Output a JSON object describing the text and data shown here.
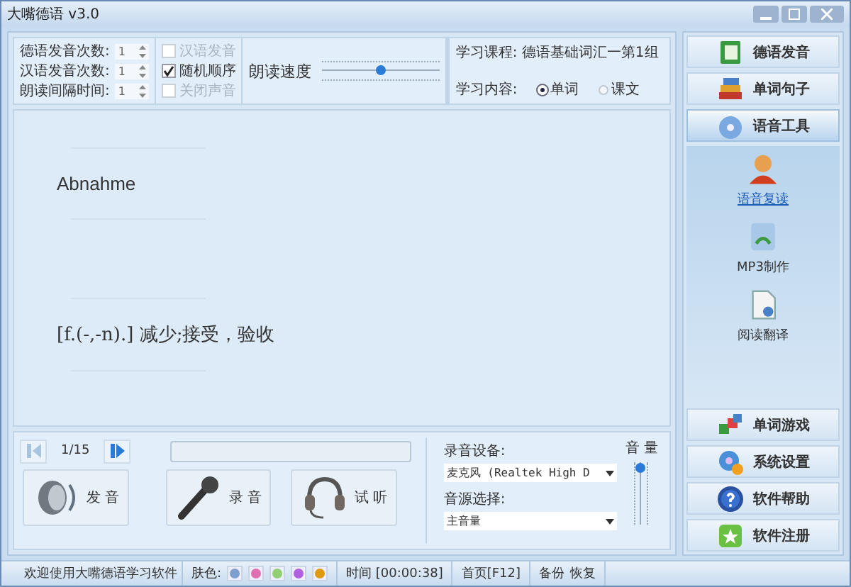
{
  "window": {
    "title": "大嘴德语 v3.0"
  },
  "settings": {
    "spinners": [
      {
        "label": "德语发音次数:",
        "value": "1"
      },
      {
        "label": "汉语发音次数:",
        "value": "1"
      },
      {
        "label": "朗读间隔时间:",
        "value": "1"
      }
    ],
    "checkboxes": [
      {
        "label": "汉语发音",
        "checked": false,
        "disabled": true
      },
      {
        "label": "随机顺序",
        "checked": true,
        "disabled": false
      },
      {
        "label": "关闭声音",
        "checked": false,
        "disabled": true
      }
    ],
    "speed": {
      "label": "朗读速度",
      "level": 0.5
    },
    "course": {
      "label": "学习课程:",
      "value": "德语基础词汇一第1组"
    },
    "content": {
      "label": "学习内容:",
      "options": [
        {
          "label": "单词",
          "selected": true
        },
        {
          "label": "课文",
          "selected": false
        }
      ]
    }
  },
  "card": {
    "word": "Abnahme",
    "meaning": "[f.(-,-n).] 减少;接受，验收"
  },
  "player": {
    "counter": "1/15",
    "progress": {
      "level": 0
    },
    "prev_disabled": true,
    "next_disabled": false,
    "buttons": [
      {
        "kind": "speaker",
        "label": "发 音"
      },
      {
        "kind": "mic",
        "label": "录 音"
      },
      {
        "kind": "headset",
        "label": "试 听"
      }
    ]
  },
  "recording": {
    "device_label": "录音设备:",
    "device": "麦克风 (Realtek High D",
    "source_label": "音源选择:",
    "source": "主音量",
    "volume_label": "音 量",
    "volume": {
      "level": 0.9
    }
  },
  "sidebar": {
    "top": [
      {
        "label": "德语发音",
        "kind": "book",
        "selected": false
      },
      {
        "label": "单词句子",
        "kind": "books",
        "selected": false
      },
      {
        "label": "语音工具",
        "kind": "cd",
        "selected": true
      }
    ],
    "tools": [
      {
        "label": "语音复读",
        "kind": "person",
        "selected": true
      },
      {
        "label": "MP3制作",
        "kind": "mp3",
        "selected": false
      },
      {
        "label": "阅读翻译",
        "kind": "doc",
        "selected": false
      }
    ],
    "bottom": [
      {
        "label": "单词游戏",
        "kind": "blocks",
        "selected": false
      },
      {
        "label": "系统设置",
        "kind": "gear",
        "selected": false
      },
      {
        "label": "软件帮助",
        "kind": "help",
        "selected": false
      },
      {
        "label": "软件注册",
        "kind": "star",
        "selected": false
      }
    ]
  },
  "status_bar": {
    "welcome": "欢迎使用大嘴德语学习软件",
    "skin_label": "肤色:",
    "skins": [
      {
        "color": "#7f9fcf"
      },
      {
        "color": "#e070b0"
      },
      {
        "color": "#90d070"
      },
      {
        "color": "#b060e0"
      },
      {
        "color": "#e09a10"
      }
    ],
    "time": "时间 [00:00:38]",
    "home": "首页[F12]",
    "backup": "备份",
    "restore": "恢复"
  }
}
